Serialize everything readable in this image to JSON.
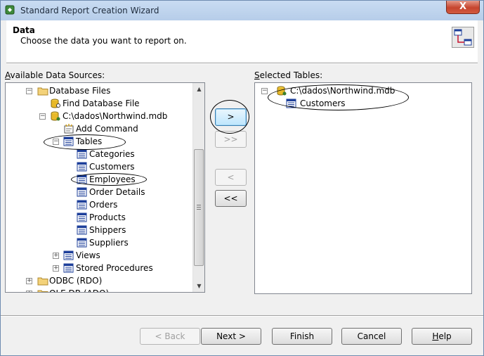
{
  "window": {
    "title": "Standard Report Creation Wizard",
    "close_label": "X"
  },
  "header": {
    "title": "Data",
    "subtitle": "Choose the data you want to report on."
  },
  "available": {
    "label_accel": "A",
    "label_rest": "vailable Data Sources:",
    "tree": [
      {
        "label": "Database Files",
        "icon": "folder-icon",
        "expander": "minus"
      },
      {
        "label": "Find Database File",
        "icon": "find-database-icon",
        "expander": ""
      },
      {
        "label": "C:\\dados\\Northwind.mdb",
        "icon": "database-icon",
        "expander": "minus"
      },
      {
        "label": "Add Command",
        "icon": "add-command-icon",
        "expander": ""
      },
      {
        "label": "Tables",
        "icon": "tables-icon",
        "expander": "minus"
      },
      {
        "label": "Categories",
        "icon": "table-icon",
        "expander": ""
      },
      {
        "label": "Customers",
        "icon": "table-icon",
        "expander": ""
      },
      {
        "label": "Employees",
        "icon": "table-icon",
        "expander": ""
      },
      {
        "label": "Order Details",
        "icon": "table-icon",
        "expander": ""
      },
      {
        "label": "Orders",
        "icon": "table-icon",
        "expander": ""
      },
      {
        "label": "Products",
        "icon": "table-icon",
        "expander": ""
      },
      {
        "label": "Shippers",
        "icon": "table-icon",
        "expander": ""
      },
      {
        "label": "Suppliers",
        "icon": "table-icon",
        "expander": ""
      },
      {
        "label": "Views",
        "icon": "views-icon",
        "expander": "plus"
      },
      {
        "label": "Stored Procedures",
        "icon": "stored-procedures-icon",
        "expander": "plus"
      },
      {
        "label": "ODBC (RDO)",
        "icon": "folder-icon",
        "expander": "plus"
      },
      {
        "label": "OLE DB (ADO)",
        "icon": "folder-icon",
        "expander": "plus"
      }
    ]
  },
  "selected": {
    "label_accel": "S",
    "label_rest": "elected Tables:",
    "tree": [
      {
        "label": "C:\\dados\\Northwind.mdb",
        "icon": "database-icon",
        "expander": "minus"
      },
      {
        "label": "Customers",
        "icon": "table-icon",
        "expander": ""
      }
    ]
  },
  "transfer": {
    "add_one": ">",
    "add_all": ">>",
    "remove_one": "<",
    "remove_all": "<<"
  },
  "footer": {
    "back": "< Back",
    "next": "Next >",
    "finish": "Finish",
    "cancel": "Cancel",
    "help_accel": "H",
    "help_rest": "elp"
  },
  "colors": {
    "titlebar": "#b6cde9",
    "close_button": "#c6452e",
    "focus_button": "#bee6fd",
    "table_icon": "#1d3f9a",
    "folder_icon": "#f3d27a"
  }
}
